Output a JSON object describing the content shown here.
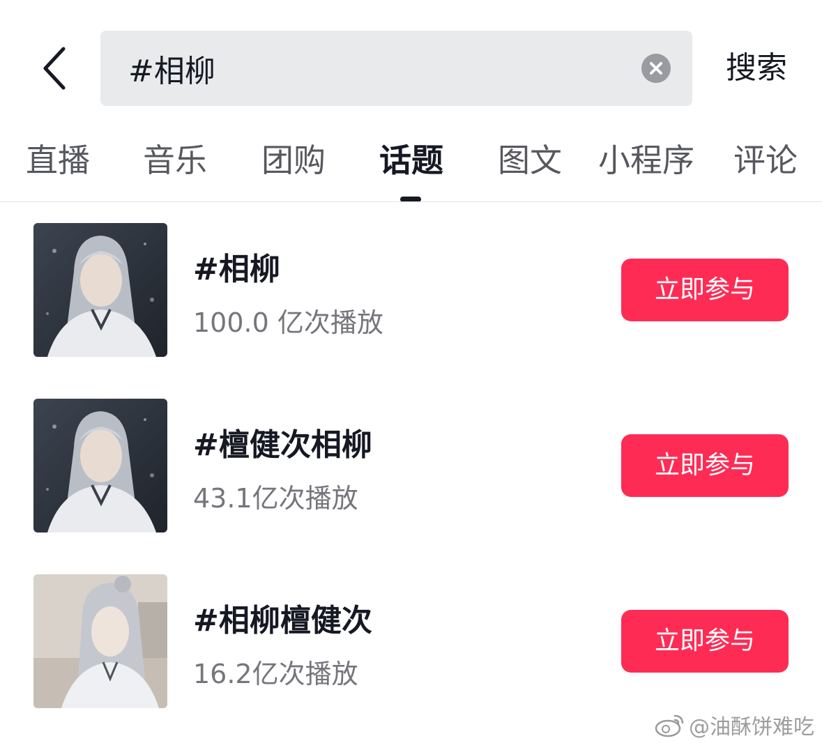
{
  "search": {
    "query": "#相柳",
    "submit_label": "搜索"
  },
  "tabs": [
    {
      "label": "直播"
    },
    {
      "label": "音乐"
    },
    {
      "label": "团购"
    },
    {
      "label": "话题"
    },
    {
      "label": "图文"
    },
    {
      "label": "小程序"
    },
    {
      "label": "评论"
    }
  ],
  "active_tab": "话题",
  "topics": [
    {
      "title": "#相柳",
      "plays": "100.0 亿次播放",
      "action_label": "立即参与"
    },
    {
      "title": "#檀健次相柳",
      "plays": "43.1亿次播放",
      "action_label": "立即参与"
    },
    {
      "title": "#相柳檀健次",
      "plays": "16.2亿次播放",
      "action_label": "立即参与"
    }
  ],
  "watermark": {
    "text": "@油酥饼难吃"
  },
  "colors": {
    "accent": "#fe2c55",
    "search_bg": "#e9eaec",
    "text_primary": "#161823",
    "text_secondary": "#75767c"
  }
}
